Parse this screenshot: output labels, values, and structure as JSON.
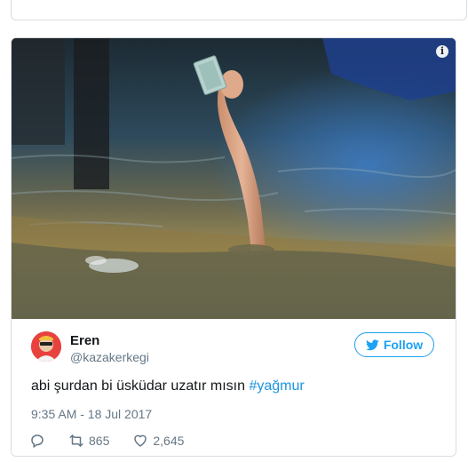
{
  "tweet": {
    "display_name": "Eren",
    "handle": "@kazakerkegi",
    "follow_label": "Follow",
    "text_before": "abi şurdan bi üsküdar uzatır mısın ",
    "hashtag": "#yağmur",
    "timestamp": "9:35 AM - 18 Jul 2017",
    "retweets": "865",
    "likes": "2,645"
  },
  "icons": {
    "media_info": "info-icon",
    "follow": "twitter-bird-icon",
    "reply": "reply-icon",
    "retweet": "retweet-icon",
    "like": "heart-icon"
  },
  "colors": {
    "accent": "#1da1f2",
    "hashtag": "#1b95e0",
    "secondary_text": "#657786",
    "primary_text": "#14171a",
    "border": "#d9dee2"
  }
}
